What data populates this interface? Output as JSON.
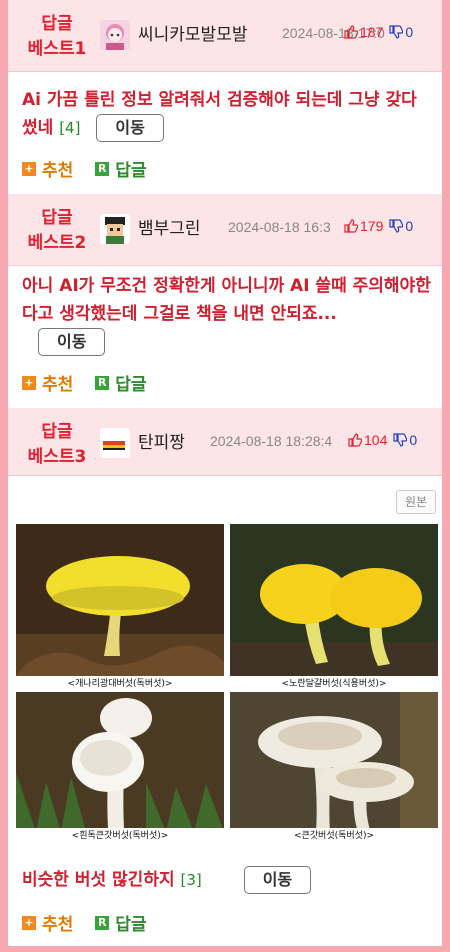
{
  "replies": [
    {
      "badge": "답글\n베스트1",
      "nickname": "씨니카모발모발",
      "date": "2024-08-18 17:0",
      "upvotes": "187",
      "downvotes": "0",
      "body": "Ai 가끔 틀린 정보 알려줘서 검증해야 되는데 그냥 갖다 썼네",
      "comment_count": "[4]",
      "move_label": "이동"
    },
    {
      "badge": "답글\n베스트2",
      "nickname": "뱀부그린",
      "date": "2024-08-18 16:3",
      "upvotes": "179",
      "downvotes": "0",
      "body": "아니 AI가 무조건 정확한게 아니니까 AI 쓸때 주의해야한다고 생각했는데 그걸로 책을 내면 안되죠...",
      "comment_count": "",
      "move_label": "이동"
    },
    {
      "badge": "답글\n베스트3",
      "nickname": "탄피짱",
      "date": "2024-08-18 18:28:4",
      "upvotes": "104",
      "downvotes": "0",
      "body": "비슷한 버섯 많긴하지",
      "comment_count": "[3]",
      "move_label": "이동",
      "original_label": "원본",
      "image_captions": [
        "<개나리광대버섯(독버섯)>",
        "<노란달걀버섯(식용버섯)>",
        "<흰독큰갓버섯(독버섯)>",
        "<큰갓버섯(독버섯)>"
      ]
    }
  ],
  "actions": {
    "recommend": "추천",
    "reply": "답글"
  },
  "colors": {
    "accent_red": "#e2202f",
    "header_bg": "#fde4e6",
    "frame_border": "#f7a8b0",
    "recommend_orange": "#e07a00",
    "reply_green": "#2e8b2e"
  }
}
